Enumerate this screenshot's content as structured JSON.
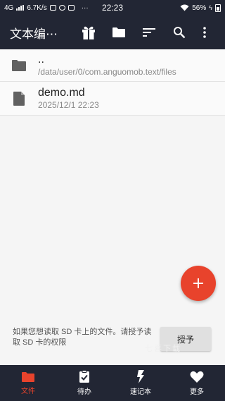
{
  "status_bar": {
    "network": "4G",
    "speed": "6.7K/s",
    "dots": "···",
    "time": "22:23",
    "battery_percent": "56%"
  },
  "toolbar": {
    "title": "文本编⋯",
    "icons": [
      "gift-icon",
      "folder-icon",
      "sort-icon",
      "search-icon",
      "more-vert-icon"
    ]
  },
  "files": [
    {
      "name": "..",
      "detail": "/data/user/0/com.anguomob.text/files",
      "kind": "folder"
    },
    {
      "name": "demo.md",
      "detail": "2025/12/1 22:23",
      "kind": "file"
    }
  ],
  "permission": {
    "message": "如果您想读取 SD 卡上的文件。请授予读取 SD 卡的权限",
    "button": "授予",
    "watermark": "七喜下载"
  },
  "bottom_nav": [
    {
      "label": "文件",
      "icon": "folder-icon",
      "active": true
    },
    {
      "label": "待办",
      "icon": "clipboard-check-icon",
      "active": false
    },
    {
      "label": "速记本",
      "icon": "lightning-icon",
      "active": false
    },
    {
      "label": "更多",
      "icon": "heart-icon",
      "active": false
    }
  ],
  "colors": {
    "bar": "#222634",
    "accent": "#e8432c"
  }
}
